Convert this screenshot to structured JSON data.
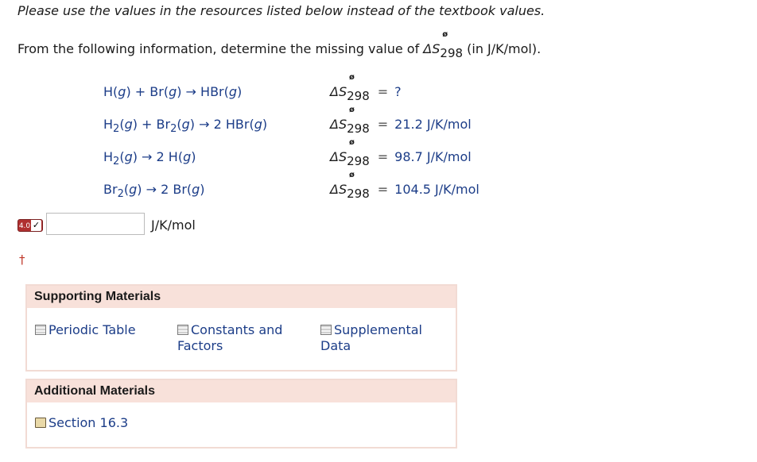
{
  "instruction": "Please use the values in the resources listed below instead of the textbook values.",
  "question": {
    "prefix": "From the following information, determine the missing value of ",
    "delta_s": "ΔS",
    "degree": "ø",
    "temp": "298",
    "suffix": " (in J/K/mol)."
  },
  "reactions": [
    {
      "reaction_html": "H(<i>g</i>) + Br(<i>g</i>) → HBr(<i>g</i>)",
      "value": "?",
      "unit": ""
    },
    {
      "reaction_html": "H<span class=\"low\">2</span>(<i>g</i>) + Br<span class=\"low\">2</span>(<i>g</i>) → 2 HBr(<i>g</i>)",
      "value": "21.2",
      "unit": " J/K/mol"
    },
    {
      "reaction_html": "H<span class=\"low\">2</span>(<i>g</i>) → 2 H(<i>g</i>)",
      "value": "98.7",
      "unit": " J/K/mol"
    },
    {
      "reaction_html": "Br<span class=\"low\">2</span>(<i>g</i>) → 2 Br(<i>g</i>)",
      "value": "104.5",
      "unit": " J/K/mol"
    }
  ],
  "answer": {
    "points_badge": "4.0",
    "check_glyph": "✓",
    "value": "",
    "unit": "J/K/mol"
  },
  "dagger": "†",
  "supporting": {
    "title": "Supporting Materials",
    "links": [
      "Periodic Table",
      "Constants and Factors",
      "Supplemental Data"
    ]
  },
  "additional": {
    "title": "Additional Materials",
    "links": [
      "Section 16.3"
    ]
  },
  "colors": {
    "link": "#1c3d88",
    "panel_header": "#f8e1da",
    "badge": "#b03030"
  }
}
